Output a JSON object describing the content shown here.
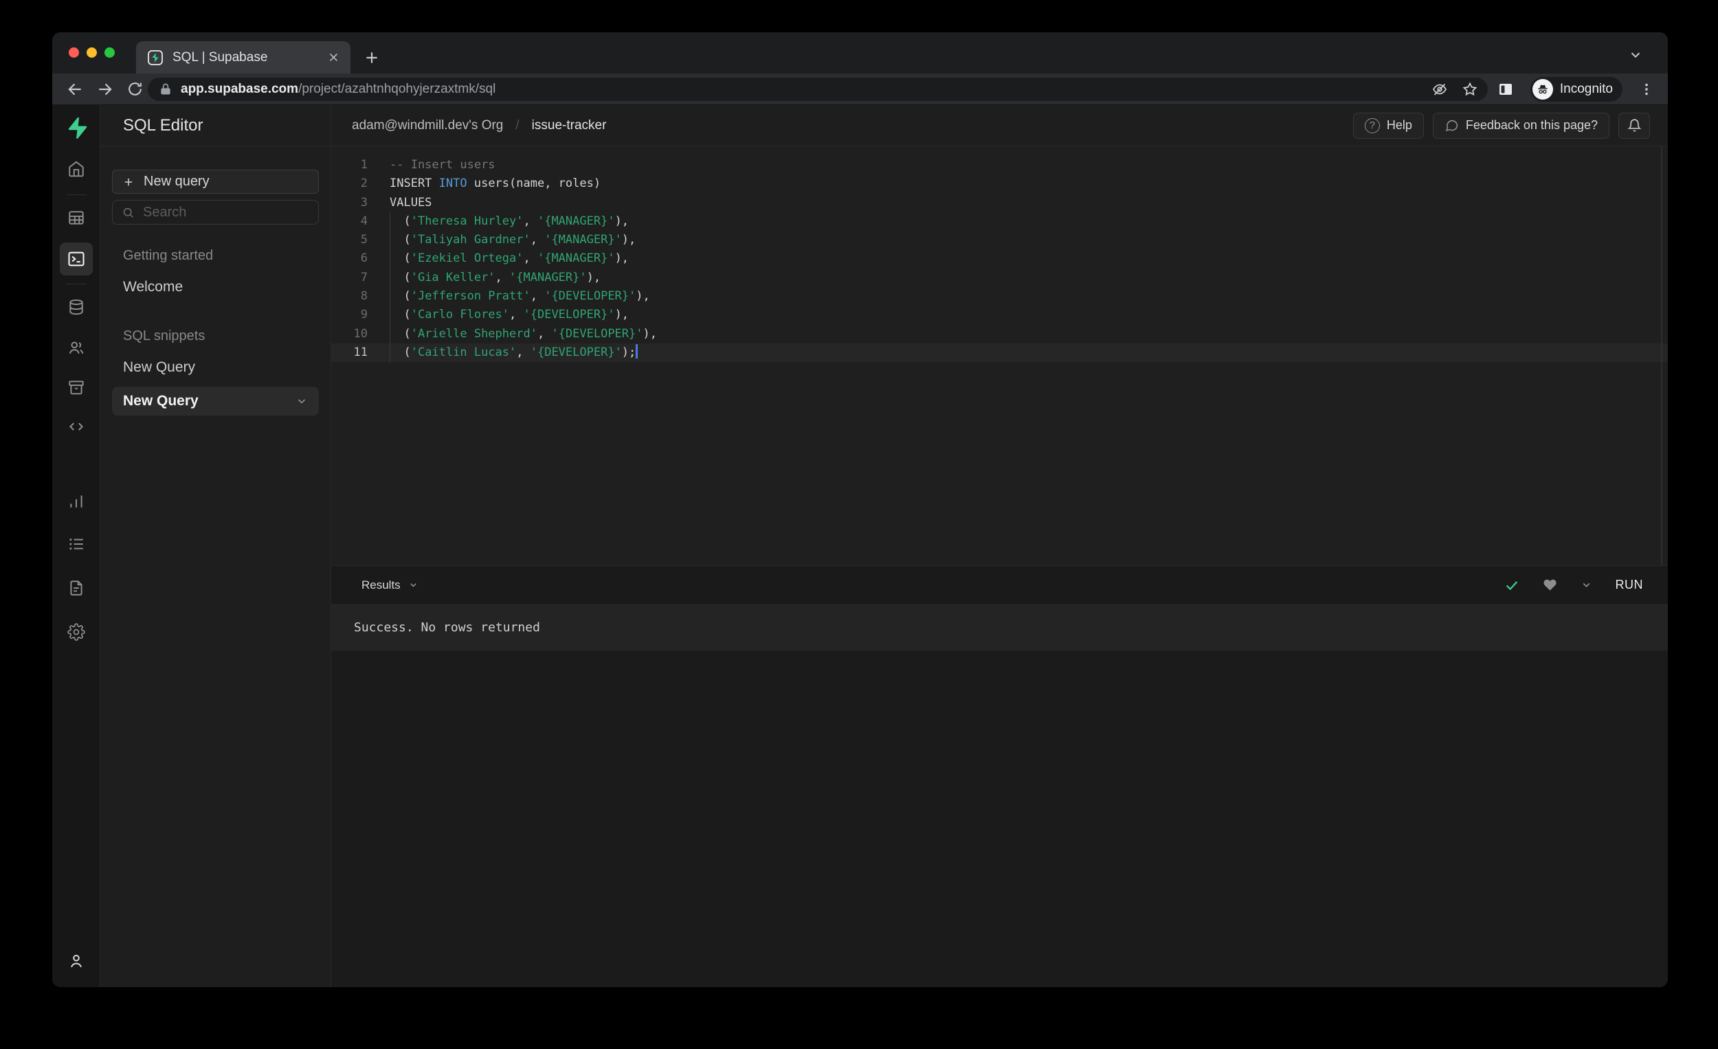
{
  "browser": {
    "tab_title": "SQL | Supabase",
    "url_domain": "app.supabase.com",
    "url_path": "/project/azahtnhqohyjerzaxtmk/sql",
    "incognito_label": "Incognito"
  },
  "app": {
    "sidebar": {
      "title": "SQL Editor",
      "new_query_button": "New query",
      "search_placeholder": "Search",
      "section_getting_started": "Getting started",
      "item_welcome": "Welcome",
      "section_sql_snippets": "SQL snippets",
      "item_new_query_1": "New Query",
      "item_new_query_2": "New Query"
    },
    "header": {
      "breadcrumb_org": "adam@windmill.dev's Org",
      "breadcrumb_separator": "/",
      "breadcrumb_project": "issue-tracker",
      "help_button": "Help",
      "feedback_button": "Feedback on this page?"
    },
    "editor": {
      "lines": [
        {
          "num": "1",
          "segments": [
            {
              "type": "comment",
              "text": "-- Insert users"
            }
          ]
        },
        {
          "num": "2",
          "segments": [
            {
              "type": "plain",
              "text": "INSERT "
            },
            {
              "type": "keyword",
              "text": "INTO"
            },
            {
              "type": "plain",
              "text": " users(name, roles)"
            }
          ]
        },
        {
          "num": "3",
          "segments": [
            {
              "type": "plain",
              "text": "VALUES"
            }
          ]
        },
        {
          "num": "4",
          "segments": [
            {
              "type": "plain",
              "text": "  ("
            },
            {
              "type": "string",
              "text": "'Theresa Hurley'"
            },
            {
              "type": "plain",
              "text": ", "
            },
            {
              "type": "string",
              "text": "'{MANAGER}'"
            },
            {
              "type": "plain",
              "text": "),"
            }
          ]
        },
        {
          "num": "5",
          "segments": [
            {
              "type": "plain",
              "text": "  ("
            },
            {
              "type": "string",
              "text": "'Taliyah Gardner'"
            },
            {
              "type": "plain",
              "text": ", "
            },
            {
              "type": "string",
              "text": "'{MANAGER}'"
            },
            {
              "type": "plain",
              "text": "),"
            }
          ]
        },
        {
          "num": "6",
          "segments": [
            {
              "type": "plain",
              "text": "  ("
            },
            {
              "type": "string",
              "text": "'Ezekiel Ortega'"
            },
            {
              "type": "plain",
              "text": ", "
            },
            {
              "type": "string",
              "text": "'{MANAGER}'"
            },
            {
              "type": "plain",
              "text": "),"
            }
          ]
        },
        {
          "num": "7",
          "segments": [
            {
              "type": "plain",
              "text": "  ("
            },
            {
              "type": "string",
              "text": "'Gia Keller'"
            },
            {
              "type": "plain",
              "text": ", "
            },
            {
              "type": "string",
              "text": "'{MANAGER}'"
            },
            {
              "type": "plain",
              "text": "),"
            }
          ]
        },
        {
          "num": "8",
          "segments": [
            {
              "type": "plain",
              "text": "  ("
            },
            {
              "type": "string",
              "text": "'Jefferson Pratt'"
            },
            {
              "type": "plain",
              "text": ", "
            },
            {
              "type": "string",
              "text": "'{DEVELOPER}'"
            },
            {
              "type": "plain",
              "text": "),"
            }
          ]
        },
        {
          "num": "9",
          "segments": [
            {
              "type": "plain",
              "text": "  ("
            },
            {
              "type": "string",
              "text": "'Carlo Flores'"
            },
            {
              "type": "plain",
              "text": ", "
            },
            {
              "type": "string",
              "text": "'{DEVELOPER}'"
            },
            {
              "type": "plain",
              "text": "),"
            }
          ]
        },
        {
          "num": "10",
          "segments": [
            {
              "type": "plain",
              "text": "  ("
            },
            {
              "type": "string",
              "text": "'Arielle Shepherd'"
            },
            {
              "type": "plain",
              "text": ", "
            },
            {
              "type": "string",
              "text": "'{DEVELOPER}'"
            },
            {
              "type": "plain",
              "text": "),"
            }
          ]
        },
        {
          "num": "11",
          "active": true,
          "cursor": true,
          "segments": [
            {
              "type": "plain",
              "text": "  ("
            },
            {
              "type": "string",
              "text": "'Caitlin Lucas'"
            },
            {
              "type": "plain",
              "text": ", "
            },
            {
              "type": "string",
              "text": "'{DEVELOPER}'"
            },
            {
              "type": "plain",
              "text": ");"
            }
          ]
        }
      ]
    },
    "results": {
      "label": "Results",
      "run_button": "RUN",
      "success_message": "Success. No rows returned"
    }
  },
  "icons": {
    "rail": [
      "supabase-logo",
      "home",
      "table-editor",
      "sql-editor",
      "database",
      "authentication",
      "storage",
      "edge-functions",
      "reports",
      "logs",
      "api-docs",
      "settings",
      "account"
    ],
    "browser": [
      "back",
      "forward",
      "refresh",
      "lock",
      "eye-off",
      "bookmark-star",
      "side-panel",
      "incognito",
      "menu-dots",
      "close-tab",
      "new-tab",
      "chevron-down"
    ]
  },
  "colors": {
    "accent_green": "#3ecf8e",
    "keyword_blue": "#569cd6",
    "string_green": "#2fa573",
    "comment_gray": "#767676",
    "cursor_blue": "#4d79e6",
    "success_check_green": "#3ecf8e",
    "traffic_red": "#ff5f57",
    "traffic_yellow": "#febc2e",
    "traffic_green": "#29c73f"
  }
}
